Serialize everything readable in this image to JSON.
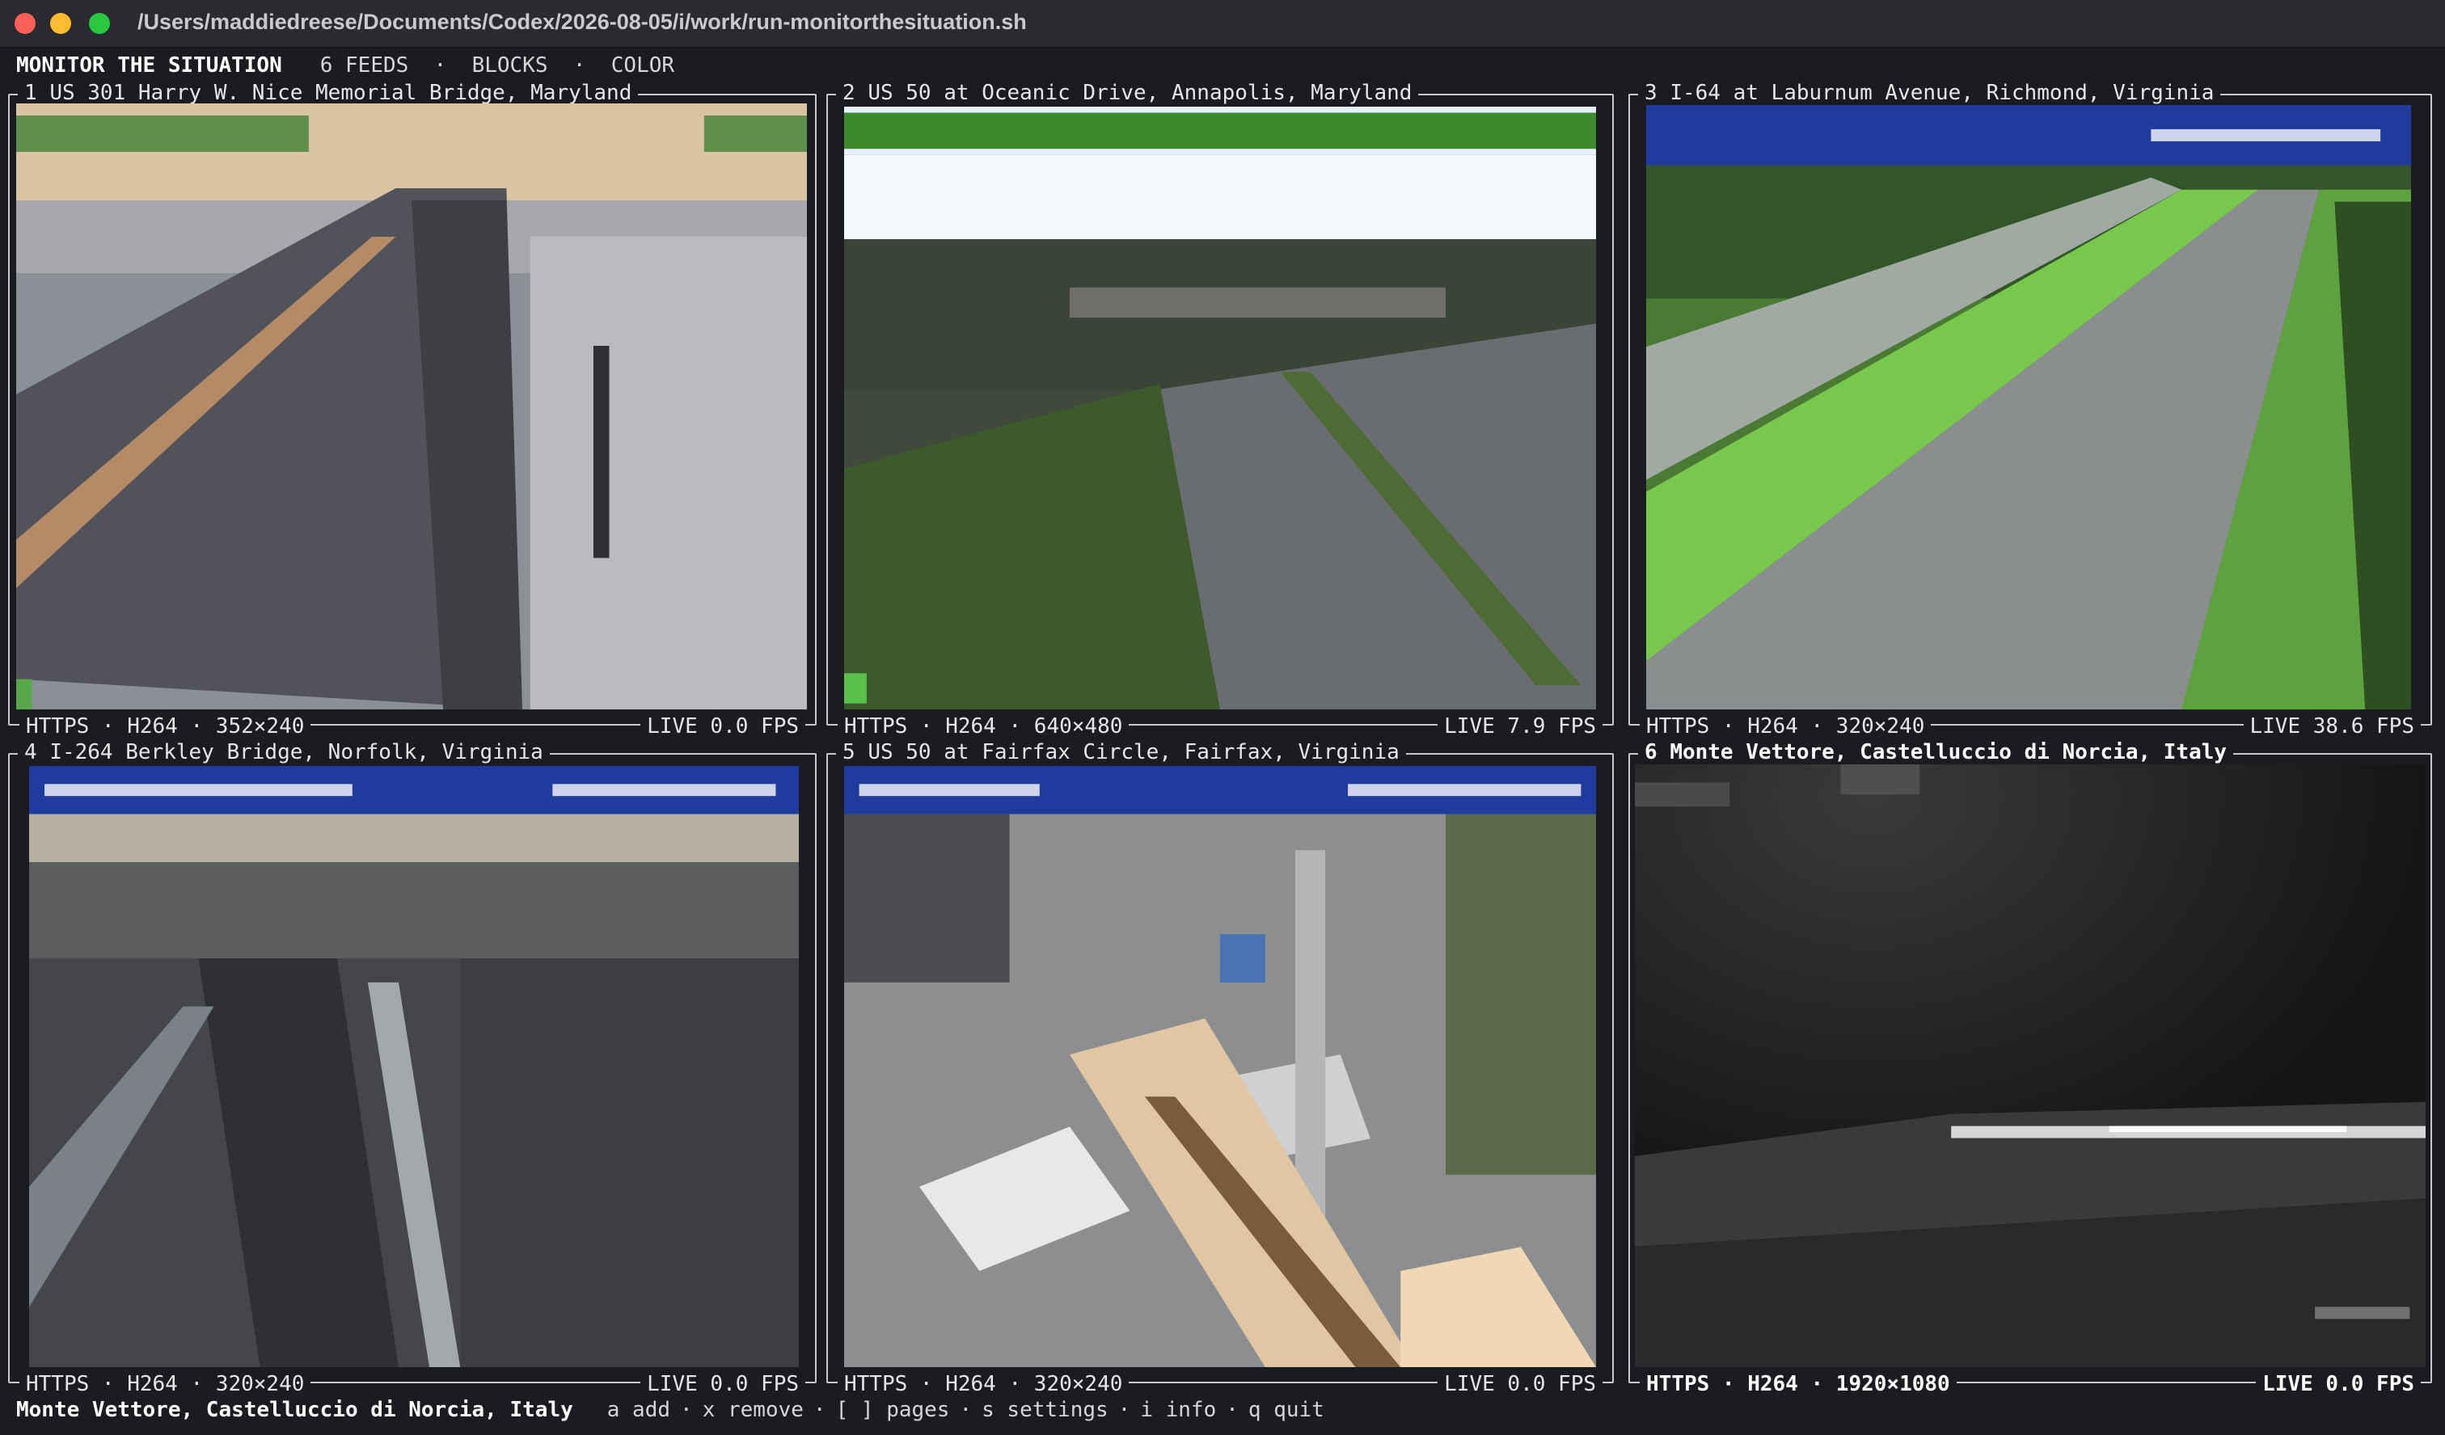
{
  "window": {
    "title": "/Users/maddiedreese/Documents/Codex/2026-08-05/i/work/run-monitorthesituation.sh"
  },
  "header": {
    "app_name": "MONITOR THE SITUATION",
    "feeds": "6 FEEDS",
    "sep": "·",
    "mode": "BLOCKS",
    "color": "COLOR"
  },
  "panels": [
    {
      "num": "1",
      "title": "US 301 Harry W. Nice Memorial Bridge, Maryland",
      "footer_left": "HTTPS · H264 · 352×240",
      "footer_right": "LIVE  0.0 FPS",
      "selected": false
    },
    {
      "num": "2",
      "title": "US 50 at Oceanic Drive, Annapolis, Maryland",
      "footer_left": "HTTPS · H264 · 640×480",
      "footer_right": "LIVE  7.9 FPS",
      "selected": false
    },
    {
      "num": "3",
      "title": "I-64 at Laburnum Avenue, Richmond, Virginia",
      "footer_left": "HTTPS · H264 · 320×240",
      "footer_right": "LIVE  38.6 FPS",
      "selected": false
    },
    {
      "num": "4",
      "title": "I-264 Berkley Bridge, Norfolk, Virginia",
      "footer_left": "HTTPS · H264 · 320×240",
      "footer_right": "LIVE  0.0 FPS",
      "selected": false
    },
    {
      "num": "5",
      "title": "US 50 at Fairfax Circle, Fairfax, Virginia",
      "footer_left": "HTTPS · H264 · 320×240",
      "footer_right": "LIVE  0.0 FPS",
      "selected": false
    },
    {
      "num": "6",
      "title": "Monte Vettore, Castelluccio di Norcia, Italy",
      "footer_left": "HTTPS · H264 · 1920×1080",
      "footer_right": "LIVE  0.0 FPS",
      "selected": true
    }
  ],
  "statusbar": {
    "selected_feed": "Monte Vettore, Castelluccio di Norcia, Italy",
    "sep": "·",
    "keys": [
      "a add",
      "x remove",
      "[ ] pages",
      "s settings",
      "i info",
      "q quit"
    ]
  },
  "colors": {
    "background": "#1b1c21",
    "titlebar": "#2a2b30",
    "border": "#c9c9c9",
    "text": "#e6e6e6"
  }
}
